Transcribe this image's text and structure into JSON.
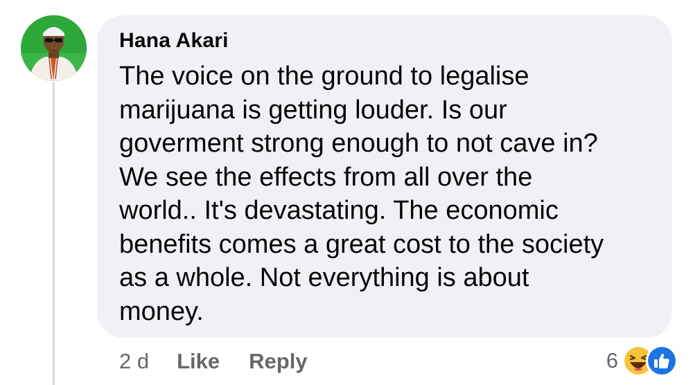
{
  "comment": {
    "author": "Hana Akari",
    "text": "The voice on the ground to legalise\nmarijuana is getting louder. Is our\ngoverment strong enough to not cave in?\nWe see the effects from all over the\nworld.. It's devastating. The economic\nbenefits comes a great cost to the society\nas a whole. Not everything is about\nmoney.",
    "timestamp": "2 d",
    "actions": {
      "like_label": "Like",
      "reply_label": "Reply"
    },
    "reactions": {
      "count": "6",
      "icons": [
        "haha-emoji-icon",
        "like-thumb-icon"
      ]
    }
  },
  "colors": {
    "bubble": "#eff1f5",
    "meta_text": "#65676b",
    "primary_text": "#050505",
    "like_blue": "#1b74e4",
    "haha_yellow": "#f7c43e",
    "avatar_bg": "#2fa83a"
  }
}
